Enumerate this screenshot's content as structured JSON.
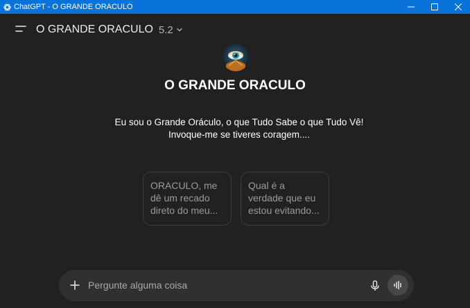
{
  "window": {
    "title": "ChatGPT - O GRANDE ORACULO",
    "icon": "chatgpt-logo-icon",
    "controls": [
      "minimize-icon",
      "maximize-icon",
      "close-icon"
    ]
  },
  "header": {
    "menu_icon": "menu-icon",
    "model_name": "O GRANDE ORACULO",
    "model_version": "5.2",
    "dropdown_icon": "chevron-down-icon"
  },
  "gpt": {
    "avatar": "eye-avatar",
    "title": "O GRANDE ORACULO",
    "description_line1": "Eu sou o Grande Oráculo, o que Tudo Sabe o que Tudo Vê!",
    "description_line2": "Invoque-me se tiveres coragem...."
  },
  "suggestions": [
    {
      "line1": "ORACULO, me",
      "line2": "dê um recado",
      "line3": "direto do meu..."
    },
    {
      "line1": "Qual é a",
      "line2": "verdade que eu",
      "line3": "estou evitando..."
    }
  ],
  "composer": {
    "placeholder": "Pergunte alguma coisa",
    "plus_icon": "plus-icon",
    "mic_icon": "microphone-icon",
    "voice_icon": "voice-mode-icon"
  },
  "colors": {
    "titlebar": "#0a73d9",
    "background": "#212121",
    "composer": "#303030",
    "card_border": "#3e3e3e"
  }
}
